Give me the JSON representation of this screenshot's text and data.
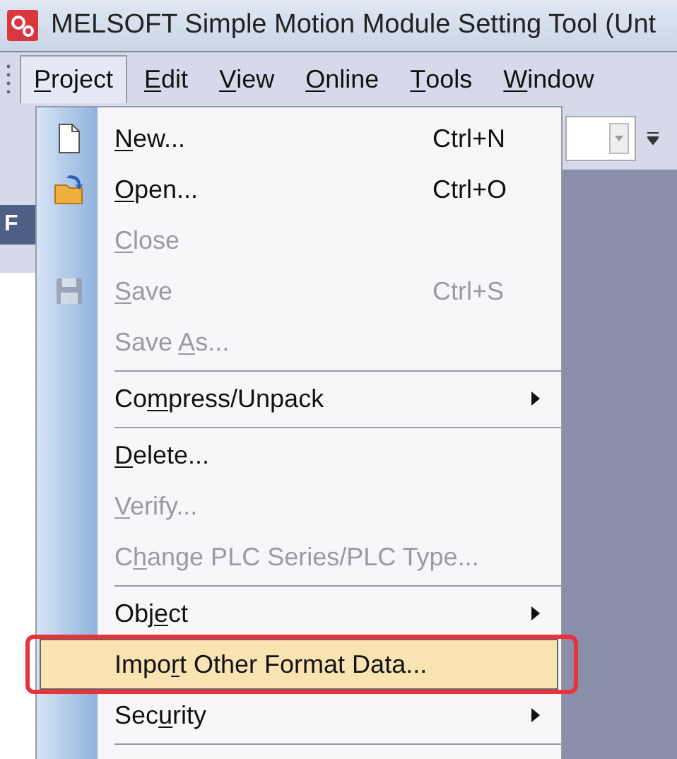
{
  "window": {
    "title": "MELSOFT Simple Motion Module Setting Tool (Unt"
  },
  "menu_bar": [
    {
      "label": {
        "key": "P",
        "after": "roject"
      },
      "selected": true
    },
    {
      "label": {
        "key": "E",
        "after": "dit"
      },
      "selected": false
    },
    {
      "label": {
        "key": "V",
        "after": "iew"
      },
      "selected": false
    },
    {
      "label": {
        "key": "O",
        "after": "nline"
      },
      "selected": false
    },
    {
      "label": {
        "key": "T",
        "after": "ools"
      },
      "selected": false
    },
    {
      "label": {
        "key": "W",
        "after": "indow"
      },
      "selected": false
    }
  ],
  "side_panel": {
    "tab": "F"
  },
  "project_menu": [
    {
      "kind": "item",
      "label": {
        "key": "N",
        "after": "ew..."
      },
      "shortcut": "Ctrl+N",
      "disabled": false,
      "submenu": false,
      "highlighted": false,
      "outlined": false
    },
    {
      "kind": "item",
      "label": {
        "key": "O",
        "after": "pen..."
      },
      "shortcut": "Ctrl+O",
      "disabled": false,
      "submenu": false,
      "highlighted": false,
      "outlined": false
    },
    {
      "kind": "item",
      "label": {
        "key": "C",
        "after": "lose"
      },
      "disabled": true,
      "submenu": false,
      "highlighted": false,
      "outlined": false
    },
    {
      "kind": "item",
      "label": {
        "key": "S",
        "after": "ave"
      },
      "shortcut": "Ctrl+S",
      "disabled": true,
      "submenu": false,
      "highlighted": false,
      "outlined": false
    },
    {
      "kind": "item",
      "label": {
        "before": "Save ",
        "key": "A",
        "after": "s..."
      },
      "disabled": true,
      "submenu": false,
      "highlighted": false,
      "outlined": false
    },
    {
      "kind": "separator"
    },
    {
      "kind": "item",
      "label": {
        "before": "Co",
        "key": "m",
        "after": "press/Unpack"
      },
      "disabled": false,
      "submenu": true,
      "highlighted": false,
      "outlined": false
    },
    {
      "kind": "separator"
    },
    {
      "kind": "item",
      "label": {
        "key": "D",
        "after": "elete..."
      },
      "disabled": false,
      "submenu": false,
      "highlighted": false,
      "outlined": false
    },
    {
      "kind": "item",
      "label": {
        "key": "V",
        "after": "erify..."
      },
      "disabled": true,
      "submenu": false,
      "highlighted": false,
      "outlined": false
    },
    {
      "kind": "item",
      "label": {
        "before": "C",
        "key": "h",
        "after": "ange PLC Series/PLC Type..."
      },
      "disabled": true,
      "submenu": false,
      "highlighted": false,
      "outlined": false
    },
    {
      "kind": "separator"
    },
    {
      "kind": "item",
      "label": {
        "before": "Obj",
        "key": "e",
        "after": "ct"
      },
      "disabled": false,
      "submenu": true,
      "highlighted": false,
      "outlined": false
    },
    {
      "kind": "item",
      "label": {
        "before": "Impo",
        "key": "r",
        "after": "t Other Format Data..."
      },
      "disabled": false,
      "submenu": false,
      "highlighted": true,
      "outlined": true
    },
    {
      "kind": "item",
      "label": {
        "before": "Sec",
        "key": "u",
        "after": "rity"
      },
      "disabled": false,
      "submenu": true,
      "highlighted": false,
      "outlined": false
    },
    {
      "kind": "separator"
    }
  ]
}
